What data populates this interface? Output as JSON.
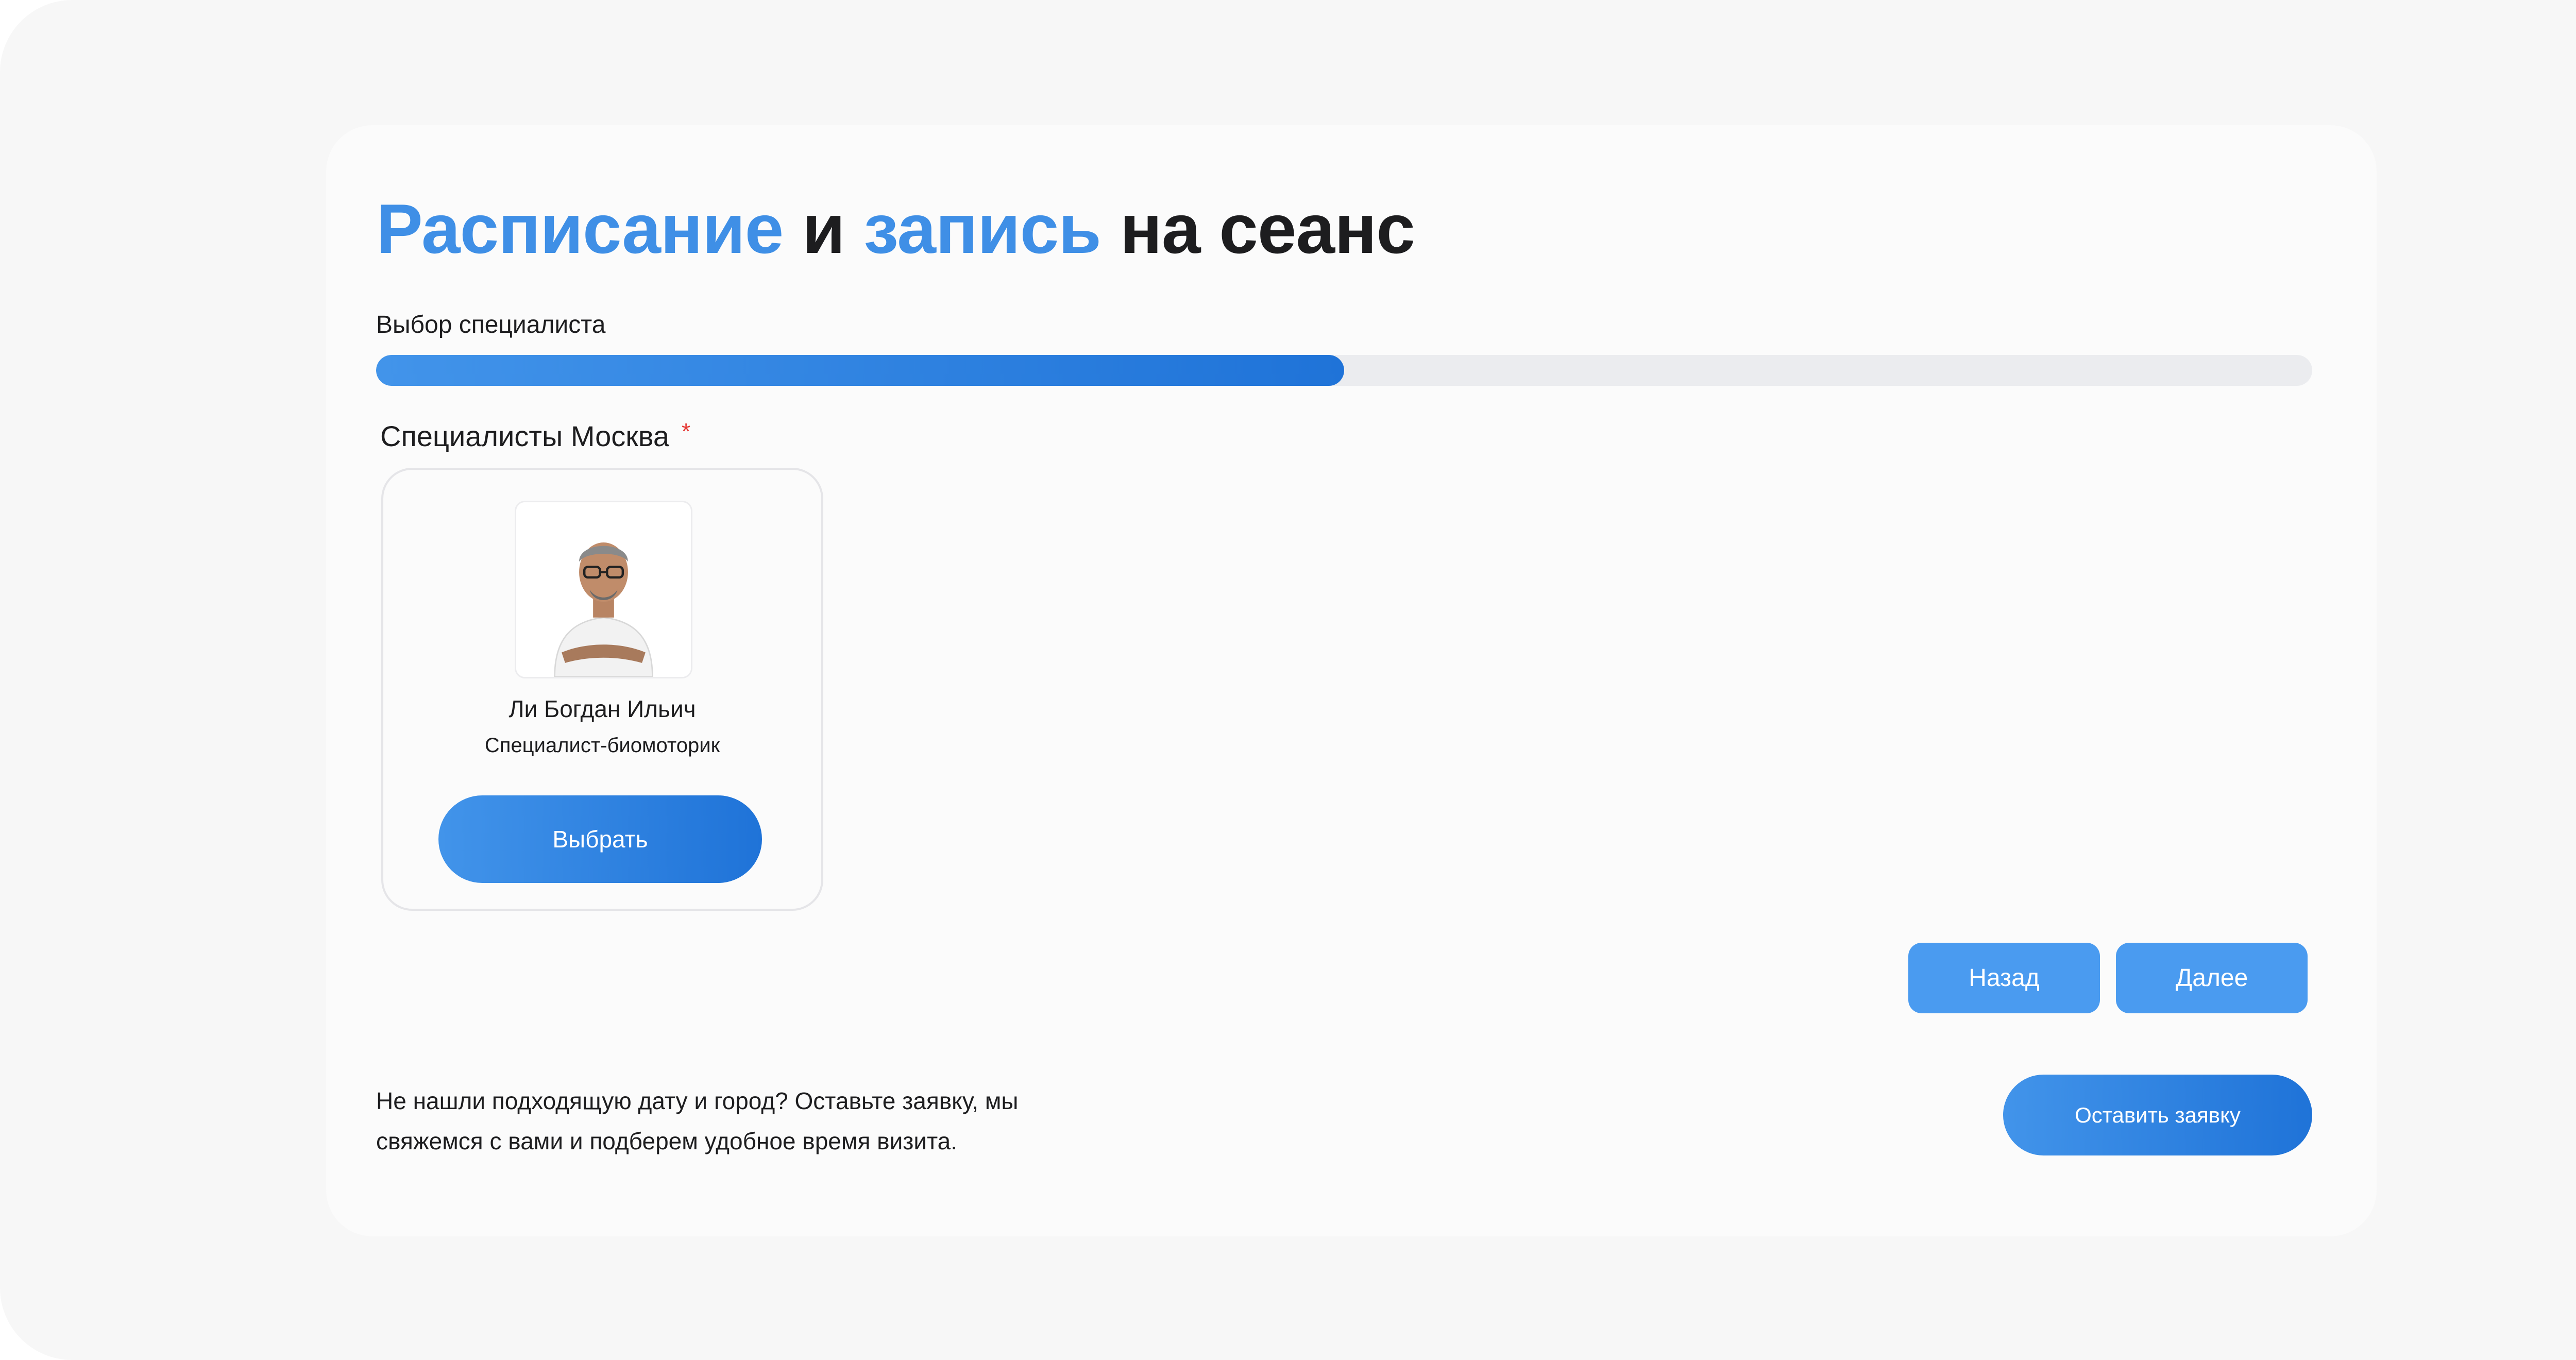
{
  "header": {
    "title_part1": "Расписание",
    "title_part2": " и ",
    "title_part3": "запись",
    "title_part4": " на сеанс"
  },
  "progress": {
    "step_label": "Выбор специалиста",
    "value_percent": 50
  },
  "specialists": {
    "section_label": "Специалисты Москва",
    "required_mark": "*",
    "items": [
      {
        "name": "Ли Богдан Ильич",
        "role": "Специалист-биомоторик",
        "select_label": "Выбрать"
      }
    ]
  },
  "navigation": {
    "back_label": "Назад",
    "next_label": "Далее"
  },
  "footer": {
    "note_line1": "Не нашли подходящую дату и город? Оставьте заявку, мы",
    "note_line2": "свяжемся с вами и подберем удобное время визита.",
    "request_label": "Оставить заявку"
  },
  "colors": {
    "accent": "#3f8fe6",
    "button": "#4a9bf0",
    "required": "#e53935"
  }
}
